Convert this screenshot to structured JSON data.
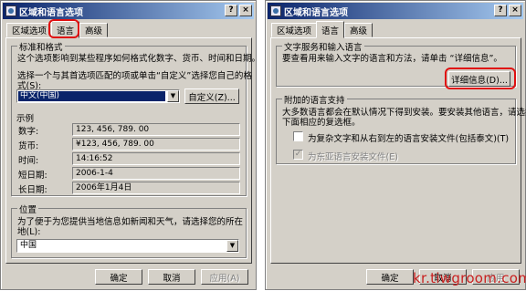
{
  "left": {
    "title": "区域和语言选项",
    "help": "?",
    "close": "×",
    "tabs": [
      "区域选项",
      "语言",
      "高级"
    ],
    "standards": {
      "group_title": "标准和格式",
      "desc": "这个选项影响到某些程序如何格式化数字、货币、时间和日期。",
      "select_label_1": "选择一个与其首选项匹配的项或单击“自定义”选择您自己的格",
      "select_label_2": "式(S):",
      "locale": "中文(中国)",
      "customize": "自定义(Z)...",
      "samples_title": "示例",
      "samples": [
        {
          "label": "数字:",
          "value": "123, 456, 789. 00"
        },
        {
          "label": "货币:",
          "value": "¥123, 456, 789. 00"
        },
        {
          "label": "时间:",
          "value": "14:16:52"
        },
        {
          "label": "短日期:",
          "value": "2006-1-4"
        },
        {
          "label": "长日期:",
          "value": "2006年1月4日"
        }
      ]
    },
    "location": {
      "group_title": "位置",
      "desc_1": "为了便于为您提供当地信息如新闻和天气，请选择您的所在",
      "desc_2": "地(L):",
      "value": "中国"
    },
    "buttons": {
      "ok": "确定",
      "cancel": "取消",
      "apply": "应用(A)"
    }
  },
  "right": {
    "title": "区域和语言选项",
    "help": "?",
    "close": "×",
    "tabs": [
      "区域选项",
      "语言",
      "高级"
    ],
    "text_services": {
      "group_title": "文字服务和输入语言",
      "desc": "要查看用来输入文字的语言和方法，请单击 “详细信息”。",
      "details": "详细信息(D)..."
    },
    "supplemental": {
      "group_title": "附加的语言支持",
      "desc_1": "大多数语言都会在默认情况下得到安装。要安装其他语言，请选择",
      "desc_2": "下面相应的复选框。",
      "complex_script": "为复杂文字和从右到左的语言安装文件(包括泰文)(T)",
      "east_asian": "为东亚语言安装文件(E)",
      "east_asian_mark": "✓"
    },
    "buttons": {
      "ok": "确定",
      "cancel": "取消",
      "apply": "应用"
    }
  },
  "watermark": "kr.tiwgroom.com",
  "colors": {
    "title_start": "#0a246a",
    "title_end": "#a6caf0",
    "face": "#d4d0c8",
    "highlight": "#e01010"
  }
}
